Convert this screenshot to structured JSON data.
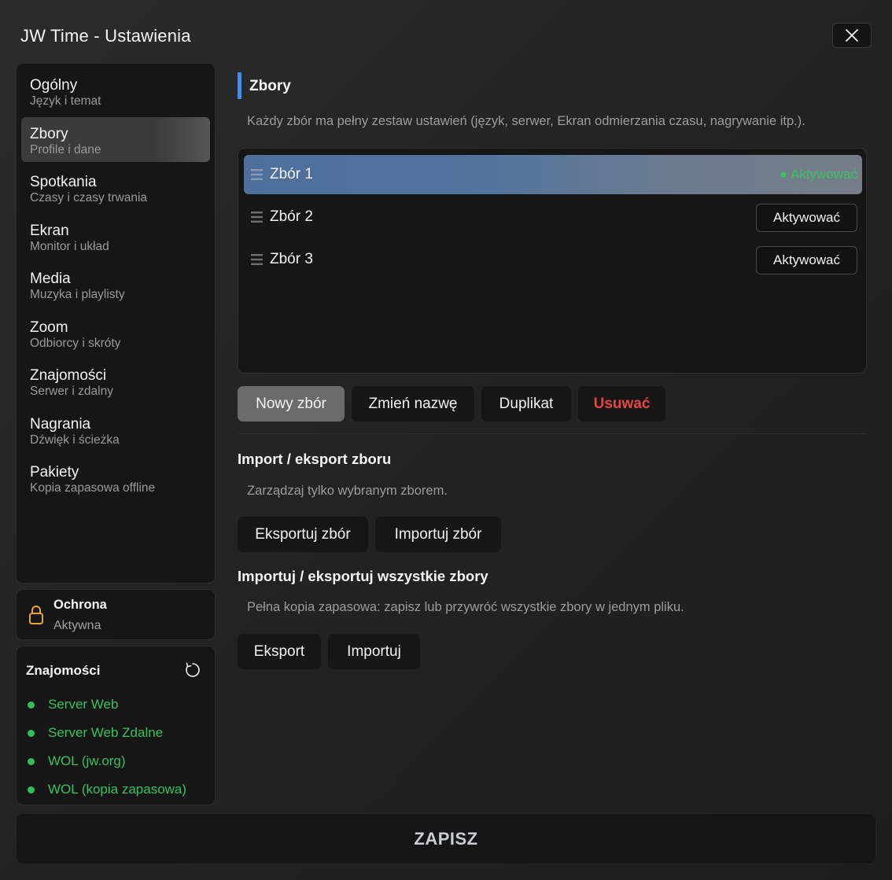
{
  "window": {
    "title": "JW Time - Ustawienia"
  },
  "sidebar": {
    "items": [
      {
        "label": "Ogólny",
        "sub": "Język i temat"
      },
      {
        "label": "Zbory",
        "sub": "Profile i dane"
      },
      {
        "label": "Spotkania",
        "sub": "Czasy i czasy trwania"
      },
      {
        "label": "Ekran",
        "sub": "Monitor i układ"
      },
      {
        "label": "Media",
        "sub": "Muzyka i playlisty"
      },
      {
        "label": "Zoom",
        "sub": "Odbiorcy i skróty"
      },
      {
        "label": "Znajomości",
        "sub": "Serwer i zdalny"
      },
      {
        "label": "Nagrania",
        "sub": "Dźwięk i ścieżka"
      },
      {
        "label": "Pakiety",
        "sub": "Kopia zapasowa offline"
      }
    ],
    "active_index": 1
  },
  "protection": {
    "title": "Ochrona",
    "status": "Aktywna"
  },
  "connections": {
    "title": "Znajomości",
    "items": [
      "Server Web",
      "Server Web Zdalne",
      "WOL (jw.org)",
      "WOL (kopia zapasowa)"
    ],
    "status_color": "#2fbf5a"
  },
  "main": {
    "section_title": "Zbory",
    "section_desc": "Każdy zbór ma pełny zestaw ustawień (język, serwer, Ekran odmierzania czasu, nagrywanie itp.).",
    "congregations": [
      {
        "name": "Zbór 1",
        "status": "● Aktywować"
      },
      {
        "name": "Zbór 2",
        "button": "Aktywować"
      },
      {
        "name": "Zbór 3",
        "button": "Aktywować"
      }
    ],
    "actions": {
      "new": "Nowy zbór",
      "rename": "Zmień nazwę",
      "duplicate": "Duplikat",
      "delete": "Usuwać"
    },
    "import_export_one": {
      "title": "Import / eksport zboru",
      "desc": "Zarządzaj tylko wybranym zborem.",
      "export": "Eksportuj zbór",
      "import": "Importuj zbór"
    },
    "import_export_all": {
      "title": "Importuj / eksportuj wszystkie zbory",
      "desc": "Pełna kopia zapasowa: zapisz lub przywróć wszystkie zbory w jednym pliku.",
      "export": "Eksport",
      "import": "Importuj"
    }
  },
  "footer": {
    "save": "ZAPISZ"
  },
  "colors": {
    "accent": "#3e8ef0",
    "success": "#36c45f",
    "danger": "#e64545",
    "lock": "#e8a33c"
  }
}
